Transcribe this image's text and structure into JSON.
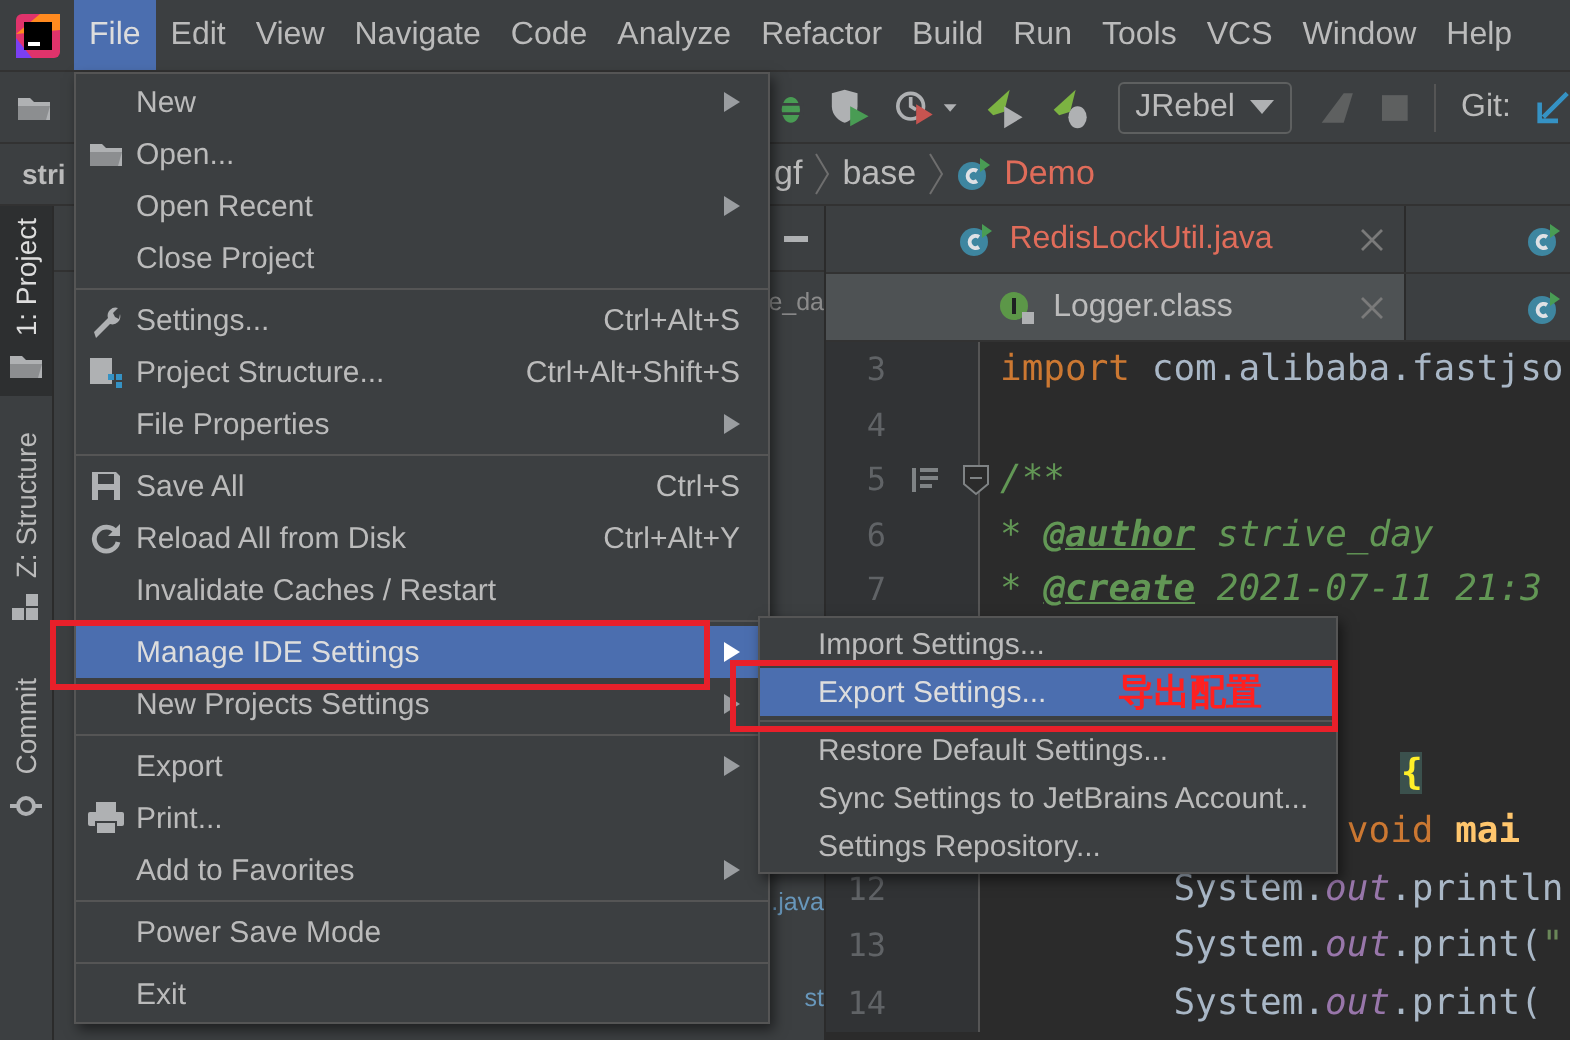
{
  "menubar": [
    {
      "label": "File",
      "selected": true
    },
    {
      "label": "Edit",
      "selected": false
    },
    {
      "label": "View",
      "selected": false
    },
    {
      "label": "Navigate",
      "selected": false
    },
    {
      "label": "Code",
      "selected": false
    },
    {
      "label": "Analyze",
      "selected": false
    },
    {
      "label": "Refactor",
      "selected": false
    },
    {
      "label": "Build",
      "selected": false
    },
    {
      "label": "Run",
      "selected": false
    },
    {
      "label": "Tools",
      "selected": false
    },
    {
      "label": "VCS",
      "selected": false
    },
    {
      "label": "Window",
      "selected": false
    },
    {
      "label": "Help",
      "selected": false
    }
  ],
  "toolbar": {
    "run_config": "JRebel",
    "vcs_label": "Git:"
  },
  "navbar": {
    "project": "stri",
    "path": [
      {
        "label": "gf",
        "kind": "package"
      },
      {
        "label": "base",
        "kind": "package"
      },
      {
        "label": "Demo",
        "kind": "class"
      }
    ]
  },
  "tool_windows": [
    {
      "label": "1: Project",
      "selected": true,
      "kind": "project"
    },
    {
      "label": "Z: Structure",
      "selected": false,
      "kind": "structure"
    },
    {
      "label": "Commit",
      "selected": false,
      "kind": "commit"
    }
  ],
  "project_panel": {
    "rows": [
      {
        "text": "e_da",
        "modified": false
      },
      {
        "text": ".java",
        "modified": true
      },
      {
        "text": "st",
        "modified": true
      }
    ]
  },
  "editor": {
    "tab_rows": [
      {
        "tabs": [
          {
            "label": "RedisLockUtil.java",
            "kind": "class",
            "has_errors": true,
            "selected": false
          }
        ]
      },
      {
        "tabs": [
          {
            "label": "Logger.class",
            "kind": "interface",
            "has_errors": false,
            "selected": true
          }
        ]
      }
    ],
    "lines_top": [
      {
        "number": "3",
        "kind": "plain",
        "segments": [
          {
            "text": "import",
            "kind": "keyword"
          },
          {
            "text": " com.alibaba.fastjso",
            "kind": "plain"
          }
        ]
      },
      {
        "number": "4"
      },
      {
        "number": "5",
        "kind": "plain",
        "fold_start": true,
        "doc_render": true,
        "segments": [
          {
            "text": "/**",
            "kind": "doc"
          }
        ]
      },
      {
        "number": "6",
        "kind": "plain",
        "segments": [
          {
            "text": " * ",
            "kind": "doc"
          },
          {
            "text": "@author",
            "kind": "doctag"
          },
          {
            "text": " strive_day",
            "kind": "doc"
          }
        ]
      },
      {
        "number": "7",
        "kind": "plain",
        "segments": [
          {
            "text": " * ",
            "kind": "doc"
          },
          {
            "text": "@create",
            "kind": "doctag"
          },
          {
            "text": " 2021-07-11 21:3",
            "kind": "doc"
          }
        ]
      }
    ],
    "lines_bottom": [
      {
        "kind": "class-decl",
        "segments": [
          {
            "text": "{",
            "kind": "brace-match"
          }
        ]
      },
      {
        "kind": "method-decl",
        "segments": [
          {
            "text": "void",
            "kind": "keyword"
          },
          {
            "text": " mai",
            "kind": "method"
          }
        ]
      },
      {
        "number": "12",
        "kind": "statement",
        "segments": [
          {
            "text": "System.",
            "kind": "plain"
          },
          {
            "text": "out",
            "kind": "field"
          },
          {
            "text": ".println",
            "kind": "plain"
          }
        ]
      },
      {
        "number": "13",
        "kind": "statement",
        "segments": [
          {
            "text": "System.",
            "kind": "plain"
          },
          {
            "text": "out",
            "kind": "field"
          },
          {
            "text": ".print(",
            "kind": "plain"
          },
          {
            "text": "\"",
            "kind": "string"
          }
        ]
      },
      {
        "number": "14",
        "kind": "statement",
        "segments": [
          {
            "text": "System.",
            "kind": "plain"
          },
          {
            "text": "out",
            "kind": "field"
          },
          {
            "text": ".print(",
            "kind": "plain"
          }
        ]
      }
    ]
  },
  "file_menu": {
    "groups": [
      {
        "items": [
          {
            "label": "New",
            "kind": "plain",
            "submenu": true,
            "selected": false,
            "outlined": false
          },
          {
            "label": "Open...",
            "kind": "open",
            "submenu": false,
            "selected": false,
            "outlined": false
          },
          {
            "label": "Open Recent",
            "kind": "plain",
            "submenu": true,
            "selected": false,
            "outlined": false
          },
          {
            "label": "Close Project",
            "kind": "plain",
            "submenu": false,
            "selected": false,
            "outlined": false
          }
        ]
      },
      {
        "items": [
          {
            "label": "Settings...",
            "kind": "settings",
            "shortcut": "Ctrl+Alt+S",
            "submenu": false,
            "selected": false,
            "outlined": false
          },
          {
            "label": "Project Structure...",
            "kind": "structure",
            "shortcut": "Ctrl+Alt+Shift+S",
            "submenu": false,
            "selected": false,
            "outlined": false
          },
          {
            "label": "File Properties",
            "kind": "plain",
            "submenu": true,
            "selected": false,
            "outlined": false
          }
        ]
      },
      {
        "items": [
          {
            "label": "Save All",
            "kind": "save",
            "shortcut": "Ctrl+S",
            "submenu": false,
            "selected": false,
            "outlined": false
          },
          {
            "label": "Reload All from Disk",
            "kind": "reload",
            "shortcut": "Ctrl+Alt+Y",
            "submenu": false,
            "selected": false,
            "outlined": false
          },
          {
            "label": "Invalidate Caches / Restart",
            "kind": "plain",
            "submenu": false,
            "selected": false,
            "outlined": false
          }
        ]
      },
      {
        "items": [
          {
            "label": "Manage IDE Settings",
            "kind": "plain",
            "submenu": true,
            "selected": true,
            "outlined": true
          },
          {
            "label": "New Projects Settings",
            "kind": "plain",
            "submenu": true,
            "selected": false,
            "outlined": false
          }
        ]
      },
      {
        "items": [
          {
            "label": "Export",
            "kind": "plain",
            "submenu": true,
            "selected": false,
            "outlined": false
          },
          {
            "label": "Print...",
            "kind": "print",
            "submenu": false,
            "selected": false,
            "outlined": false
          },
          {
            "label": "Add to Favorites",
            "kind": "plain",
            "submenu": true,
            "selected": false,
            "outlined": false
          }
        ]
      },
      {
        "items": [
          {
            "label": "Power Save Mode",
            "kind": "plain",
            "submenu": false,
            "selected": false,
            "outlined": false
          }
        ]
      },
      {
        "items": [
          {
            "label": "Exit",
            "kind": "plain",
            "submenu": false,
            "selected": false,
            "outlined": false
          }
        ]
      }
    ]
  },
  "settings_submenu": {
    "groups": [
      {
        "items": [
          {
            "label": "Import Settings...",
            "selected": false,
            "outlined": false
          },
          {
            "label": "Export Settings...",
            "selected": true,
            "outlined": true,
            "note": "导出配置"
          }
        ]
      },
      {
        "items": [
          {
            "label": "Restore Default Settings...",
            "selected": false,
            "outlined": false
          },
          {
            "label": "Sync Settings to JetBrains Account...",
            "selected": false,
            "outlined": false
          },
          {
            "label": "Settings Repository...",
            "selected": false,
            "outlined": false
          }
        ]
      }
    ]
  }
}
